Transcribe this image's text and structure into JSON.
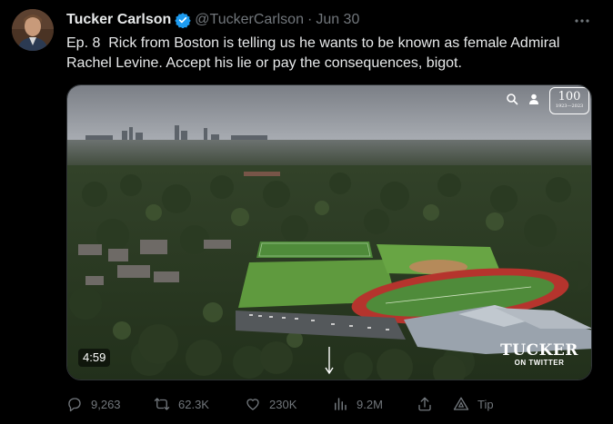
{
  "author": {
    "display_name": "Tucker Carlson",
    "verified_icon": "verified-badge-icon",
    "handle": "@TuckerCarlson",
    "separator": "·",
    "date": "Jun 30"
  },
  "tweet": {
    "text": "Ep. 8  Rick from Boston is telling us he wants to be known as female Admiral\nRachel Levine. Accept his lie or pay the consequences, bigot."
  },
  "media": {
    "duration": "4:59",
    "badge_number": "100",
    "badge_years": "1923—2023",
    "watermark_title": "TUCKER",
    "watermark_subtitle": "ON TWITTER"
  },
  "actions": {
    "replies": "9,263",
    "retweets": "62.3K",
    "likes": "230K",
    "views": "9.2M",
    "tip_label": "Tip"
  },
  "colors": {
    "background": "#000000",
    "text_primary": "#e7e9ea",
    "text_secondary": "#71767b",
    "verified": "#1d9bf0"
  }
}
